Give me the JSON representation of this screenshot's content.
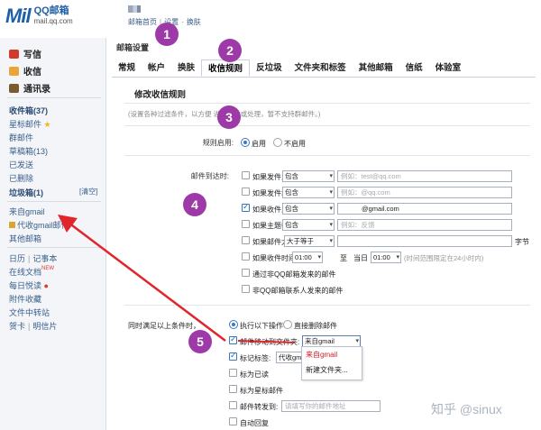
{
  "header": {
    "logo_mark": "M",
    "logo_rest": "il",
    "brand": "QQ邮箱",
    "domain": "mail.qq.com",
    "links": [
      "邮箱首页",
      "设置",
      "换肤"
    ]
  },
  "sidebar": {
    "write": "写信",
    "inbox": "收信",
    "contacts": "通讯录",
    "folders": [
      {
        "label": "收件箱(37)",
        "bold": true
      },
      {
        "label": "星标邮件"
      },
      {
        "label": "群邮件"
      },
      {
        "label": "草稿箱(13)"
      },
      {
        "label": "已发送"
      },
      {
        "label": "已删除"
      },
      {
        "label": "垃圾箱(1)",
        "bold": true
      }
    ],
    "clear": "[清空]",
    "my_folder": "来自gmail",
    "proxy_gmail": "代收gmail邮件",
    "other_mail": "其他邮箱",
    "tools_row1": [
      "日历",
      "记事本"
    ],
    "tools": [
      "在线文档",
      "每日悦读",
      "附件收藏",
      "文件中转站"
    ],
    "tools_last": [
      "贺卡",
      "明信片"
    ],
    "new_tag": "NEW"
  },
  "main": {
    "title": "邮箱设置",
    "tabs": [
      "常规",
      "帐户",
      "换肤",
      "收信规则",
      "反垃圾",
      "文件夹和标签",
      "其他邮箱",
      "信纸",
      "体验室"
    ],
    "active_tab": "收信规则",
    "section_title": "修改收信规则",
    "description": "(设置各种过滤条件，以方便        进行分类或处理，暂不支持群邮件。)",
    "rule_enable_label": "规则启用:",
    "enable": "启用",
    "disable": "不启用",
    "arrive_label": "邮件到达时:",
    "conditions": [
      {
        "label": "如果发件人",
        "op": "包含",
        "placeholder": "例如：test@qq.com",
        "checked": false
      },
      {
        "label": "如果发件域",
        "op": "包含",
        "placeholder": "例如：@qq.com",
        "checked": false
      },
      {
        "label": "如果收件人",
        "op": "包含",
        "value": "@gmail.com",
        "checked": true
      },
      {
        "label": "如果主题中",
        "op": "包含",
        "placeholder": "例如：反馈",
        "checked": false
      },
      {
        "label": "如果邮件大小",
        "op": "大于等于",
        "unit": "字节",
        "checked": false
      }
    ],
    "time_row": {
      "label": "如果收件时间从当日",
      "from": "01:00",
      "to_label": "至",
      "day_label": "当日",
      "to": "01:00",
      "hint": "(时间范围限定在24小时内)"
    },
    "extra_conditions": [
      "通过非QQ邮箱发来的邮件",
      "非QQ邮箱联系人发来的邮件"
    ],
    "action_label": "同时满足以上条件时，",
    "do_action": "执行以下操作",
    "delete_direct": "直接删除邮件",
    "actions": {
      "move_label": "邮件移动到文件夹:",
      "move_value": "来自gmail",
      "tag_label": "标记标签:",
      "tag_value": "代收gm",
      "mark_read": "标为已读",
      "mark_star": "标为星标邮件",
      "forward_label": "邮件转发到:",
      "forward_placeholder": "请填写你的邮件地址",
      "auto_reply": "自动回复"
    },
    "dropdown_items": [
      "来自gmail",
      "新建文件夹..."
    ]
  },
  "annotations": [
    "1",
    "2",
    "3",
    "4",
    "5"
  ],
  "watermark": "知乎 @sinux",
  "colors": {
    "accent": "#1f5fa8",
    "badge": "#9e3aa8",
    "arrow": "#e0262c"
  }
}
